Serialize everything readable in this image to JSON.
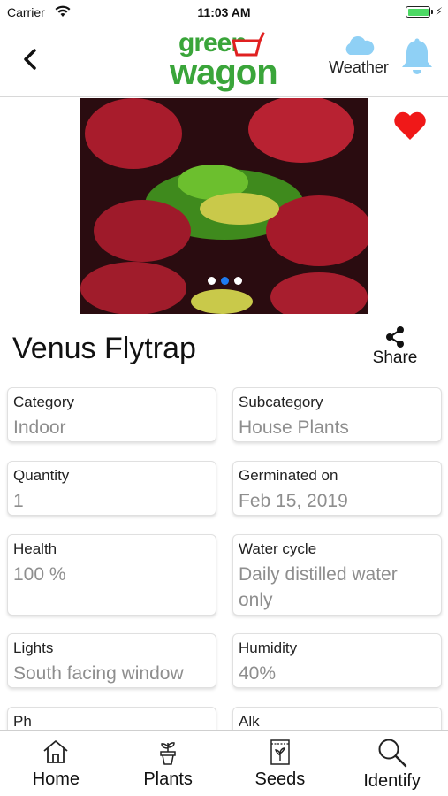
{
  "status_bar": {
    "carrier": "Carrier",
    "time": "11:03 AM"
  },
  "nav": {
    "logo_line1": "green",
    "logo_line2": "wagon",
    "weather_label": "Weather",
    "icons": [
      "chevron-left-icon",
      "cloud-icon",
      "bell-icon"
    ]
  },
  "hero": {
    "favorited": true,
    "carousel_dots": 3,
    "active_dot": 2
  },
  "plant": {
    "name": "Venus Flytrap",
    "share_label": "Share"
  },
  "details": [
    {
      "key": "Category",
      "value": "Indoor"
    },
    {
      "key": "Subcategory",
      "value": "House Plants"
    },
    {
      "key": "Quantity",
      "value": "1"
    },
    {
      "key": "Germinated on",
      "value": "Feb 15, 2019"
    },
    {
      "key": "Health",
      "value": "100 %"
    },
    {
      "key": "Water cycle",
      "value": "Daily distilled water only"
    },
    {
      "key": "Lights",
      "value": "South facing window"
    },
    {
      "key": "Humidity",
      "value": "40%"
    },
    {
      "key": "Ph",
      "value": ""
    },
    {
      "key": "Alk",
      "value": ""
    }
  ],
  "tabs": [
    {
      "label": "Home",
      "icon": "home-icon"
    },
    {
      "label": "Plants",
      "icon": "potted-plant-icon"
    },
    {
      "label": "Seeds",
      "icon": "seed-packet-icon"
    },
    {
      "label": "Identify",
      "icon": "magnifier-icon"
    }
  ],
  "colors": {
    "brand_green": "#3aa53a",
    "logo_red": "#e02020",
    "heart": "#f01818",
    "weather_blue": "#8fd0f5",
    "active_dot": "#1e7bf0"
  }
}
